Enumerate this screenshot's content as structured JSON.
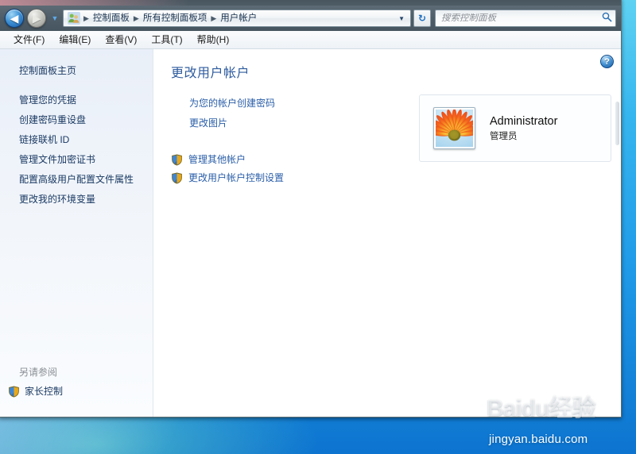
{
  "window": {
    "nav": {
      "back_label": "◀",
      "forward_label": "▶",
      "history_chevron": "▼",
      "refresh_label": "↻",
      "breadcrumb_icon": "user-accounts-icon",
      "breadcrumb": [
        {
          "label": "控制面板"
        },
        {
          "label": "所有控制面板项"
        },
        {
          "label": "用户帐户"
        }
      ],
      "breadcrumb_separator": "▶",
      "breadcrumb_dropdown": "▼"
    },
    "search": {
      "placeholder": "搜索控制面板",
      "value": "",
      "icon": "search-icon"
    },
    "menubar": [
      {
        "label": "文件(F)"
      },
      {
        "label": "编辑(E)"
      },
      {
        "label": "查看(V)"
      },
      {
        "label": "工具(T)"
      },
      {
        "label": "帮助(H)"
      }
    ]
  },
  "sidebar": {
    "home_label": "控制面板主页",
    "items": [
      {
        "label": "管理您的凭据"
      },
      {
        "label": "创建密码重设盘"
      },
      {
        "label": "链接联机 ID"
      },
      {
        "label": "管理文件加密证书"
      },
      {
        "label": "配置高级用户配置文件属性"
      },
      {
        "label": "更改我的环境变量"
      }
    ],
    "see_also": {
      "title": "另请参阅",
      "items": [
        {
          "label": "家长控制",
          "icon": "shield-icon"
        }
      ]
    }
  },
  "content": {
    "help_label": "?",
    "title": "更改用户帐户",
    "primary_links": [
      {
        "label": "为您的帐户创建密码"
      },
      {
        "label": "更改图片"
      }
    ],
    "shield_links": [
      {
        "label": "管理其他帐户",
        "icon": "shield-icon"
      },
      {
        "label": "更改用户帐户控制设置",
        "icon": "shield-icon"
      }
    ],
    "account": {
      "avatar_icon": "flower-avatar",
      "name": "Administrator",
      "role": "管理员"
    }
  },
  "watermark": {
    "brand": "Baidu经验",
    "url": "jingyan.baidu.com"
  },
  "colors": {
    "accent_link": "#2a5ea8",
    "title": "#2f5c9e",
    "desktop": "#1f9ae8",
    "chrome": "#4e5c66"
  }
}
